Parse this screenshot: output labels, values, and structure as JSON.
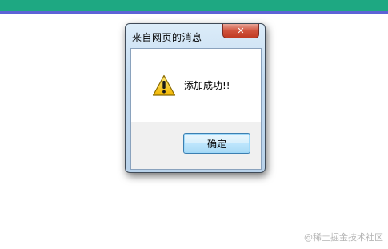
{
  "dialog": {
    "title": "来自网页的消息",
    "close_symbol": "✕",
    "message": "添加成功!!",
    "icon": "warning-icon",
    "ok_label": "确定"
  },
  "watermark": "@稀土掘金技术社区",
  "colors": {
    "top_band": "#1ea882",
    "top_band_line": "#5c63d6",
    "close_button": "#d0523c",
    "ok_button_border": "#3c7fb1"
  }
}
